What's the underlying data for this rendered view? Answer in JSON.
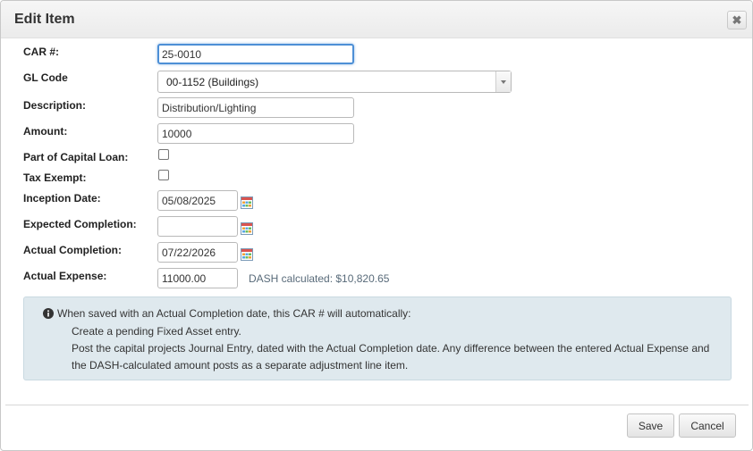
{
  "dialog": {
    "title": "Edit Item",
    "close_symbol": "✖"
  },
  "form": {
    "car_label": "CAR #:",
    "car_value": "25-0010",
    "gl_label": "GL Code",
    "gl_value": "00-1152 (Buildings)",
    "description_label": "Description:",
    "description_value": "Distribution/Lighting",
    "amount_label": "Amount:",
    "amount_value": "10000",
    "capital_loan_label": "Part of Capital Loan:",
    "capital_loan_checked": false,
    "tax_exempt_label": "Tax Exempt:",
    "tax_exempt_checked": false,
    "inception_label": "Inception Date:",
    "inception_value": "05/08/2025",
    "expected_label": "Expected Completion:",
    "expected_value": "",
    "actual_completion_label": "Actual Completion:",
    "actual_completion_value": "07/22/2026",
    "actual_expense_label": "Actual Expense:",
    "actual_expense_value": "11000.00",
    "dash_calculated": "DASH calculated: $10,820.65"
  },
  "info": {
    "intro": "When saved with an Actual Completion date, this CAR # will automatically:",
    "items": [
      "Create a pending Fixed Asset entry.",
      "Post the capital projects Journal Entry, dated with the Actual Completion date. Any difference between the entered Actual Expense and the DASH-calculated amount posts as a separate adjustment line item."
    ]
  },
  "footer": {
    "save_label": "Save",
    "cancel_label": "Cancel"
  },
  "icons": {
    "calendar": "calendar-icon",
    "info": "info-icon",
    "close": "close-icon",
    "dropdown": "chevron-down-icon"
  },
  "colors": {
    "focus_border": "#4d8fd6",
    "info_background": "#dfe9ee",
    "title_bar": "#efefef"
  }
}
